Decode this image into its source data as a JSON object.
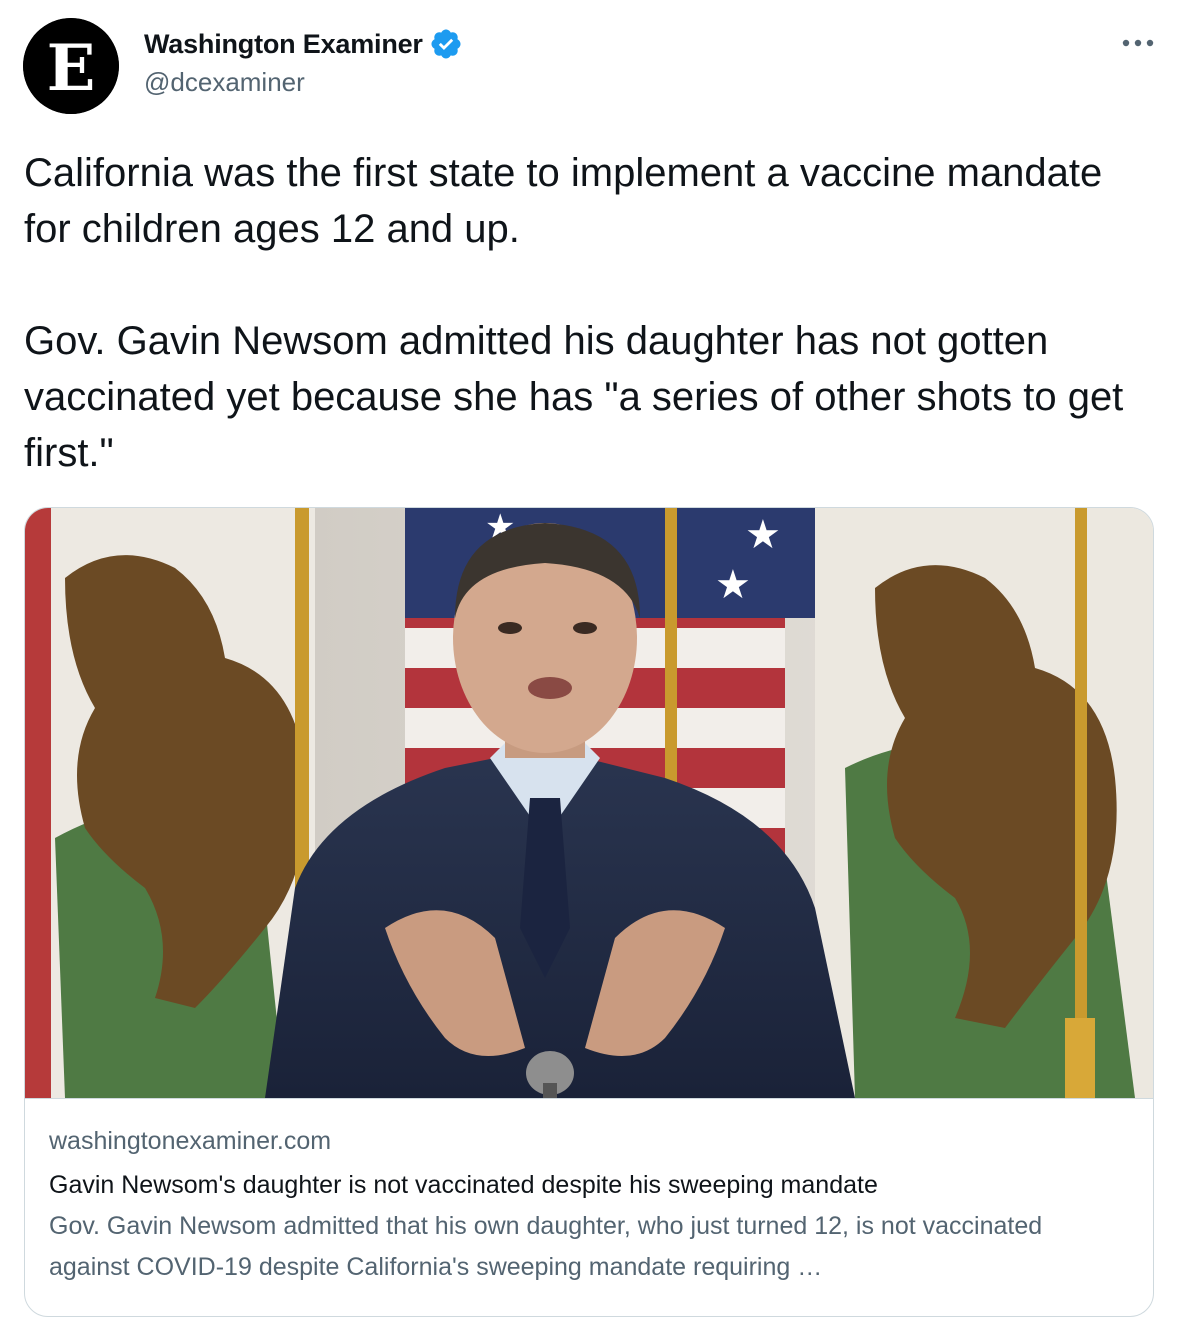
{
  "author": {
    "display_name": "Washington Examiner",
    "handle": "@dcexaminer",
    "verified": true,
    "avatar_letter": "E"
  },
  "tweet": {
    "paragraphs": [
      "California was the first state to implement a vaccine mandate for children ages 12 and up.",
      "Gov. Gavin Newsom admitted his daughter has not gotten vaccinated yet because she has \"a series of other shots to get first.\""
    ]
  },
  "link_card": {
    "domain": "washingtonexaminer.com",
    "title": "Gavin Newsom's daughter is not vaccinated despite his sweeping mandate",
    "description": "Gov. Gavin Newsom admitted that his own daughter, who just turned 12, is not vaccinated against COVID-19 despite California's sweeping mandate requiring …",
    "image_subject": "man in suit gesturing in front of California and US flags"
  },
  "icons": {
    "verified": "verified-badge-icon",
    "more": "more-options-icon"
  },
  "colors": {
    "text_primary": "#0f1419",
    "text_secondary": "#536471",
    "verified_blue": "#1d9bf0",
    "border": "#cfd9de"
  }
}
